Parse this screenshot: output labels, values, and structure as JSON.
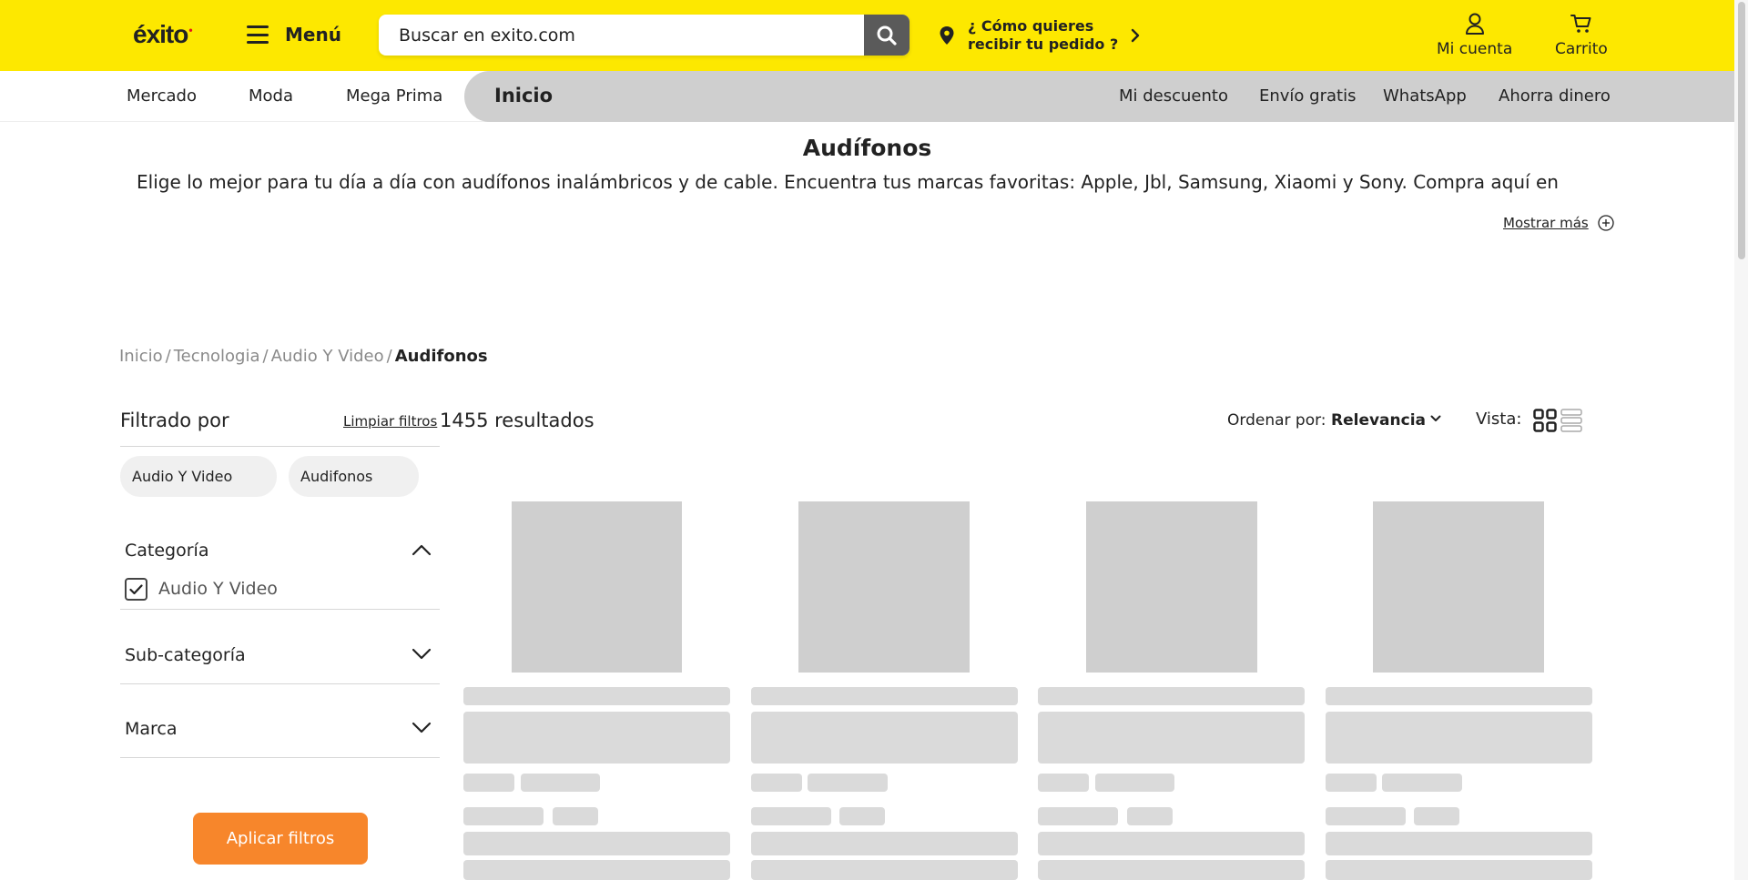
{
  "header": {
    "logo": "éxito",
    "menu_label": "Menú",
    "search": {
      "placeholder": "Buscar en exito.com"
    },
    "delivery": {
      "line1": "¿ Cómo quieres",
      "line2": "recibir tu pedido ?"
    },
    "account_label": "Mi cuenta",
    "cart_label": "Carrito",
    "accent": "#fde800"
  },
  "nav": {
    "left": [
      "Mercado",
      "Moda",
      "Mega Prima"
    ],
    "home": "Inicio",
    "right": [
      "Mi descuento",
      "Envío gratis",
      "WhatsApp",
      "Ahorra dinero"
    ]
  },
  "intro": {
    "title": "Audífonos",
    "description": "Elige lo mejor para tu día a día con audífonos inalámbricos y de cable. Encuentra tus marcas favoritas: Apple, Jbl, Samsung, Xiaomi y Sony. Compra aquí en",
    "show_more": "Mostrar más"
  },
  "breadcrumb": [
    "Inicio",
    "Tecnologia",
    "Audio Y Video",
    "Audifonos"
  ],
  "filters": {
    "title": "Filtrado por",
    "clear": "Limpiar filtros",
    "chips": [
      "Audio Y Video",
      "Audifonos"
    ],
    "sections": [
      {
        "label": "Categoría",
        "expanded": true,
        "options": [
          {
            "label": "Audio Y Video",
            "checked": true
          }
        ]
      },
      {
        "label": "Sub-categoría",
        "expanded": false
      },
      {
        "label": "Marca",
        "expanded": false
      }
    ],
    "apply": "Aplicar filtros"
  },
  "results": {
    "count_text": "1455 resultados",
    "sort_label": "Ordenar por:",
    "sort_value": "Relevancia",
    "view_label": "Vista:"
  },
  "colors": {
    "apply_button": "#f7862b",
    "skeleton": "#d3d3d3"
  }
}
